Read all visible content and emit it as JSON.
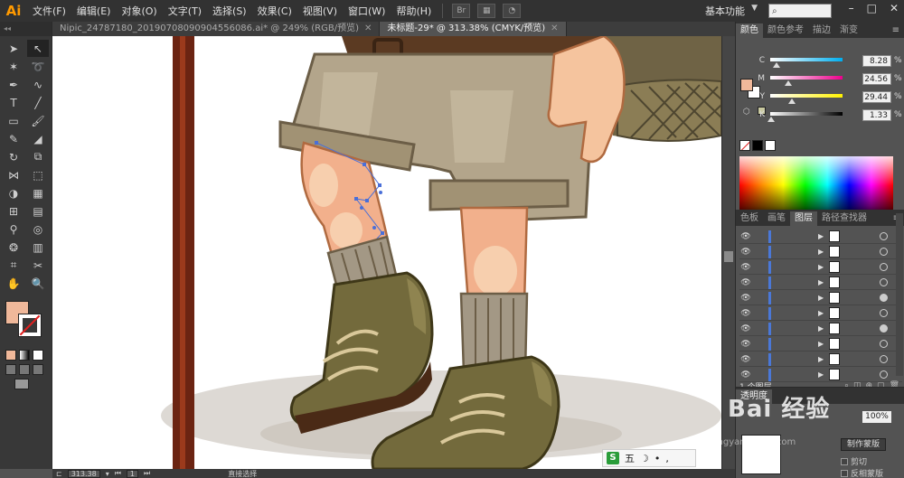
{
  "app": {
    "logo": "Ai",
    "menus": [
      "文件(F)",
      "编辑(E)",
      "对象(O)",
      "文字(T)",
      "选择(S)",
      "效果(C)",
      "视图(V)",
      "窗口(W)",
      "帮助(H)"
    ],
    "bridge_label": "Br",
    "workspace": "基本功能",
    "window_controls": [
      "–",
      "□",
      "✕"
    ]
  },
  "tabs": [
    {
      "label": "Nipic_24787180_20190708090904556086.ai* @ 249% (RGB/预览)",
      "close": "✕"
    },
    {
      "label": "未标题-29* @ 313.38% (CMYK/预览)",
      "close": "✕"
    }
  ],
  "status": {
    "zoom": "313.38",
    "page": "1",
    "tool": "直接选择"
  },
  "color_panel": {
    "tabs": [
      "颜色",
      "颜色参考",
      "描边",
      "渐变"
    ],
    "channels": [
      {
        "label": "C",
        "value": "8.28",
        "fraction": 0.0828,
        "color": "#00aeef"
      },
      {
        "label": "M",
        "value": "24.56",
        "fraction": 0.2456,
        "color": "#ec008c"
      },
      {
        "label": "Y",
        "value": "29.44",
        "fraction": 0.2944,
        "color": "#fff200"
      },
      {
        "label": "K",
        "value": "1.33",
        "fraction": 0.0133,
        "color": "#000000"
      }
    ],
    "fill_color": "#f0b89a",
    "percent": "%"
  },
  "layers_panel": {
    "tabs": [
      "色板",
      "画笔",
      "图层",
      "路径查找器"
    ],
    "footer_count": "1 个图层",
    "row_count": 10
  },
  "transparency_panel": {
    "tab": "透明度",
    "opacity": "100%",
    "mask_button": "制作蒙版",
    "clip_label": "剪切",
    "invert_label": "反相蒙版"
  },
  "watermark": {
    "text": "Bai 经验",
    "sub": "jingyan.baidu.com"
  },
  "ime": {
    "logo": "S",
    "items": [
      "五",
      "☽",
      "•",
      ","
    ]
  }
}
